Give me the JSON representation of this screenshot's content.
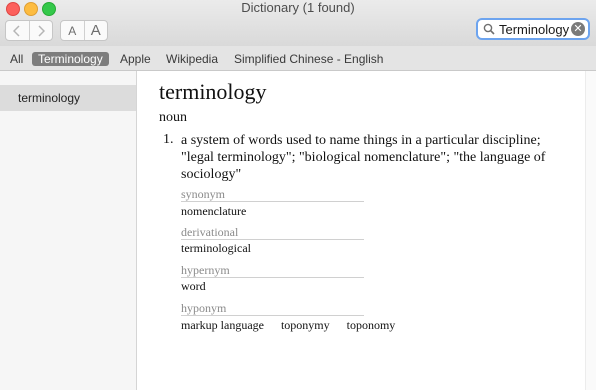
{
  "window": {
    "title": "Dictionary (1 found)",
    "nav_back_icon": "chevron-left",
    "nav_forward_icon": "chevron-right",
    "font_smaller_label": "A",
    "font_larger_label": "A"
  },
  "search": {
    "value": "Terminology",
    "icon": "magnifier",
    "clear_icon": "clear-x",
    "clear_glyph": "✕",
    "focus_color": "#6da4ef"
  },
  "tabs": [
    {
      "label": "All",
      "active": false
    },
    {
      "label": "Terminology",
      "active": true
    },
    {
      "label": "Apple",
      "active": false
    },
    {
      "label": "Wikipedia",
      "active": false
    },
    {
      "label": "Simplified Chinese - English",
      "active": false
    }
  ],
  "sidebar": {
    "items": [
      {
        "label": "terminology",
        "selected": true
      }
    ]
  },
  "entry": {
    "headword": "terminology",
    "part_of_speech": "noun",
    "senses": [
      {
        "number": "1.",
        "definition": "a system of words used to name things in a particular discipline; \"legal terminology\"; \"biological nomenclature\"; \"the language of sociology\""
      }
    ],
    "sections": [
      {
        "label": "synonym",
        "values": [
          "nomenclature"
        ]
      },
      {
        "label": "derivational",
        "values": [
          "terminological"
        ]
      },
      {
        "label": "hypernym",
        "values": [
          "word"
        ]
      },
      {
        "label": "hyponym",
        "values": [
          "markup language",
          "toponymy",
          "toponomy"
        ]
      }
    ]
  }
}
